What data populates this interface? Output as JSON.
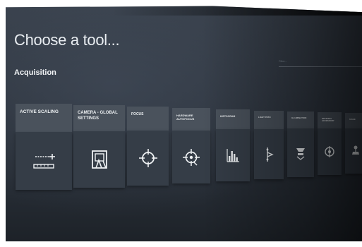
{
  "page": {
    "title": "Choose a tool...",
    "section": "Acquisition",
    "search_placeholder": "Filter..."
  },
  "tools": [
    {
      "label": "ACTIVE SCALING",
      "icon": "scale-ruler-icon"
    },
    {
      "label": "CAMERA - GLOBAL SETTINGS",
      "icon": "camera-settings-icon"
    },
    {
      "label": "FOCUS",
      "icon": "crosshair-icon"
    },
    {
      "label": "HARDWARE AUTOFOCUS",
      "icon": "autofocus-crosshair-icon"
    },
    {
      "label": "HISTOGRAM",
      "icon": "histogram-icon"
    },
    {
      "label": "LIGHT PATH",
      "icon": "light-path-icon"
    },
    {
      "label": "ILLUMINATION",
      "icon": "illumination-icon"
    },
    {
      "label": "OPTIONAL ACCESSORY",
      "icon": "accessory-icon"
    },
    {
      "label": "STAGE",
      "icon": "stage-icon"
    }
  ],
  "colors": {
    "background": "#2f3640",
    "tile_header": "#4a525c",
    "tile_body": "#353d47",
    "text": "#eef1f3"
  }
}
